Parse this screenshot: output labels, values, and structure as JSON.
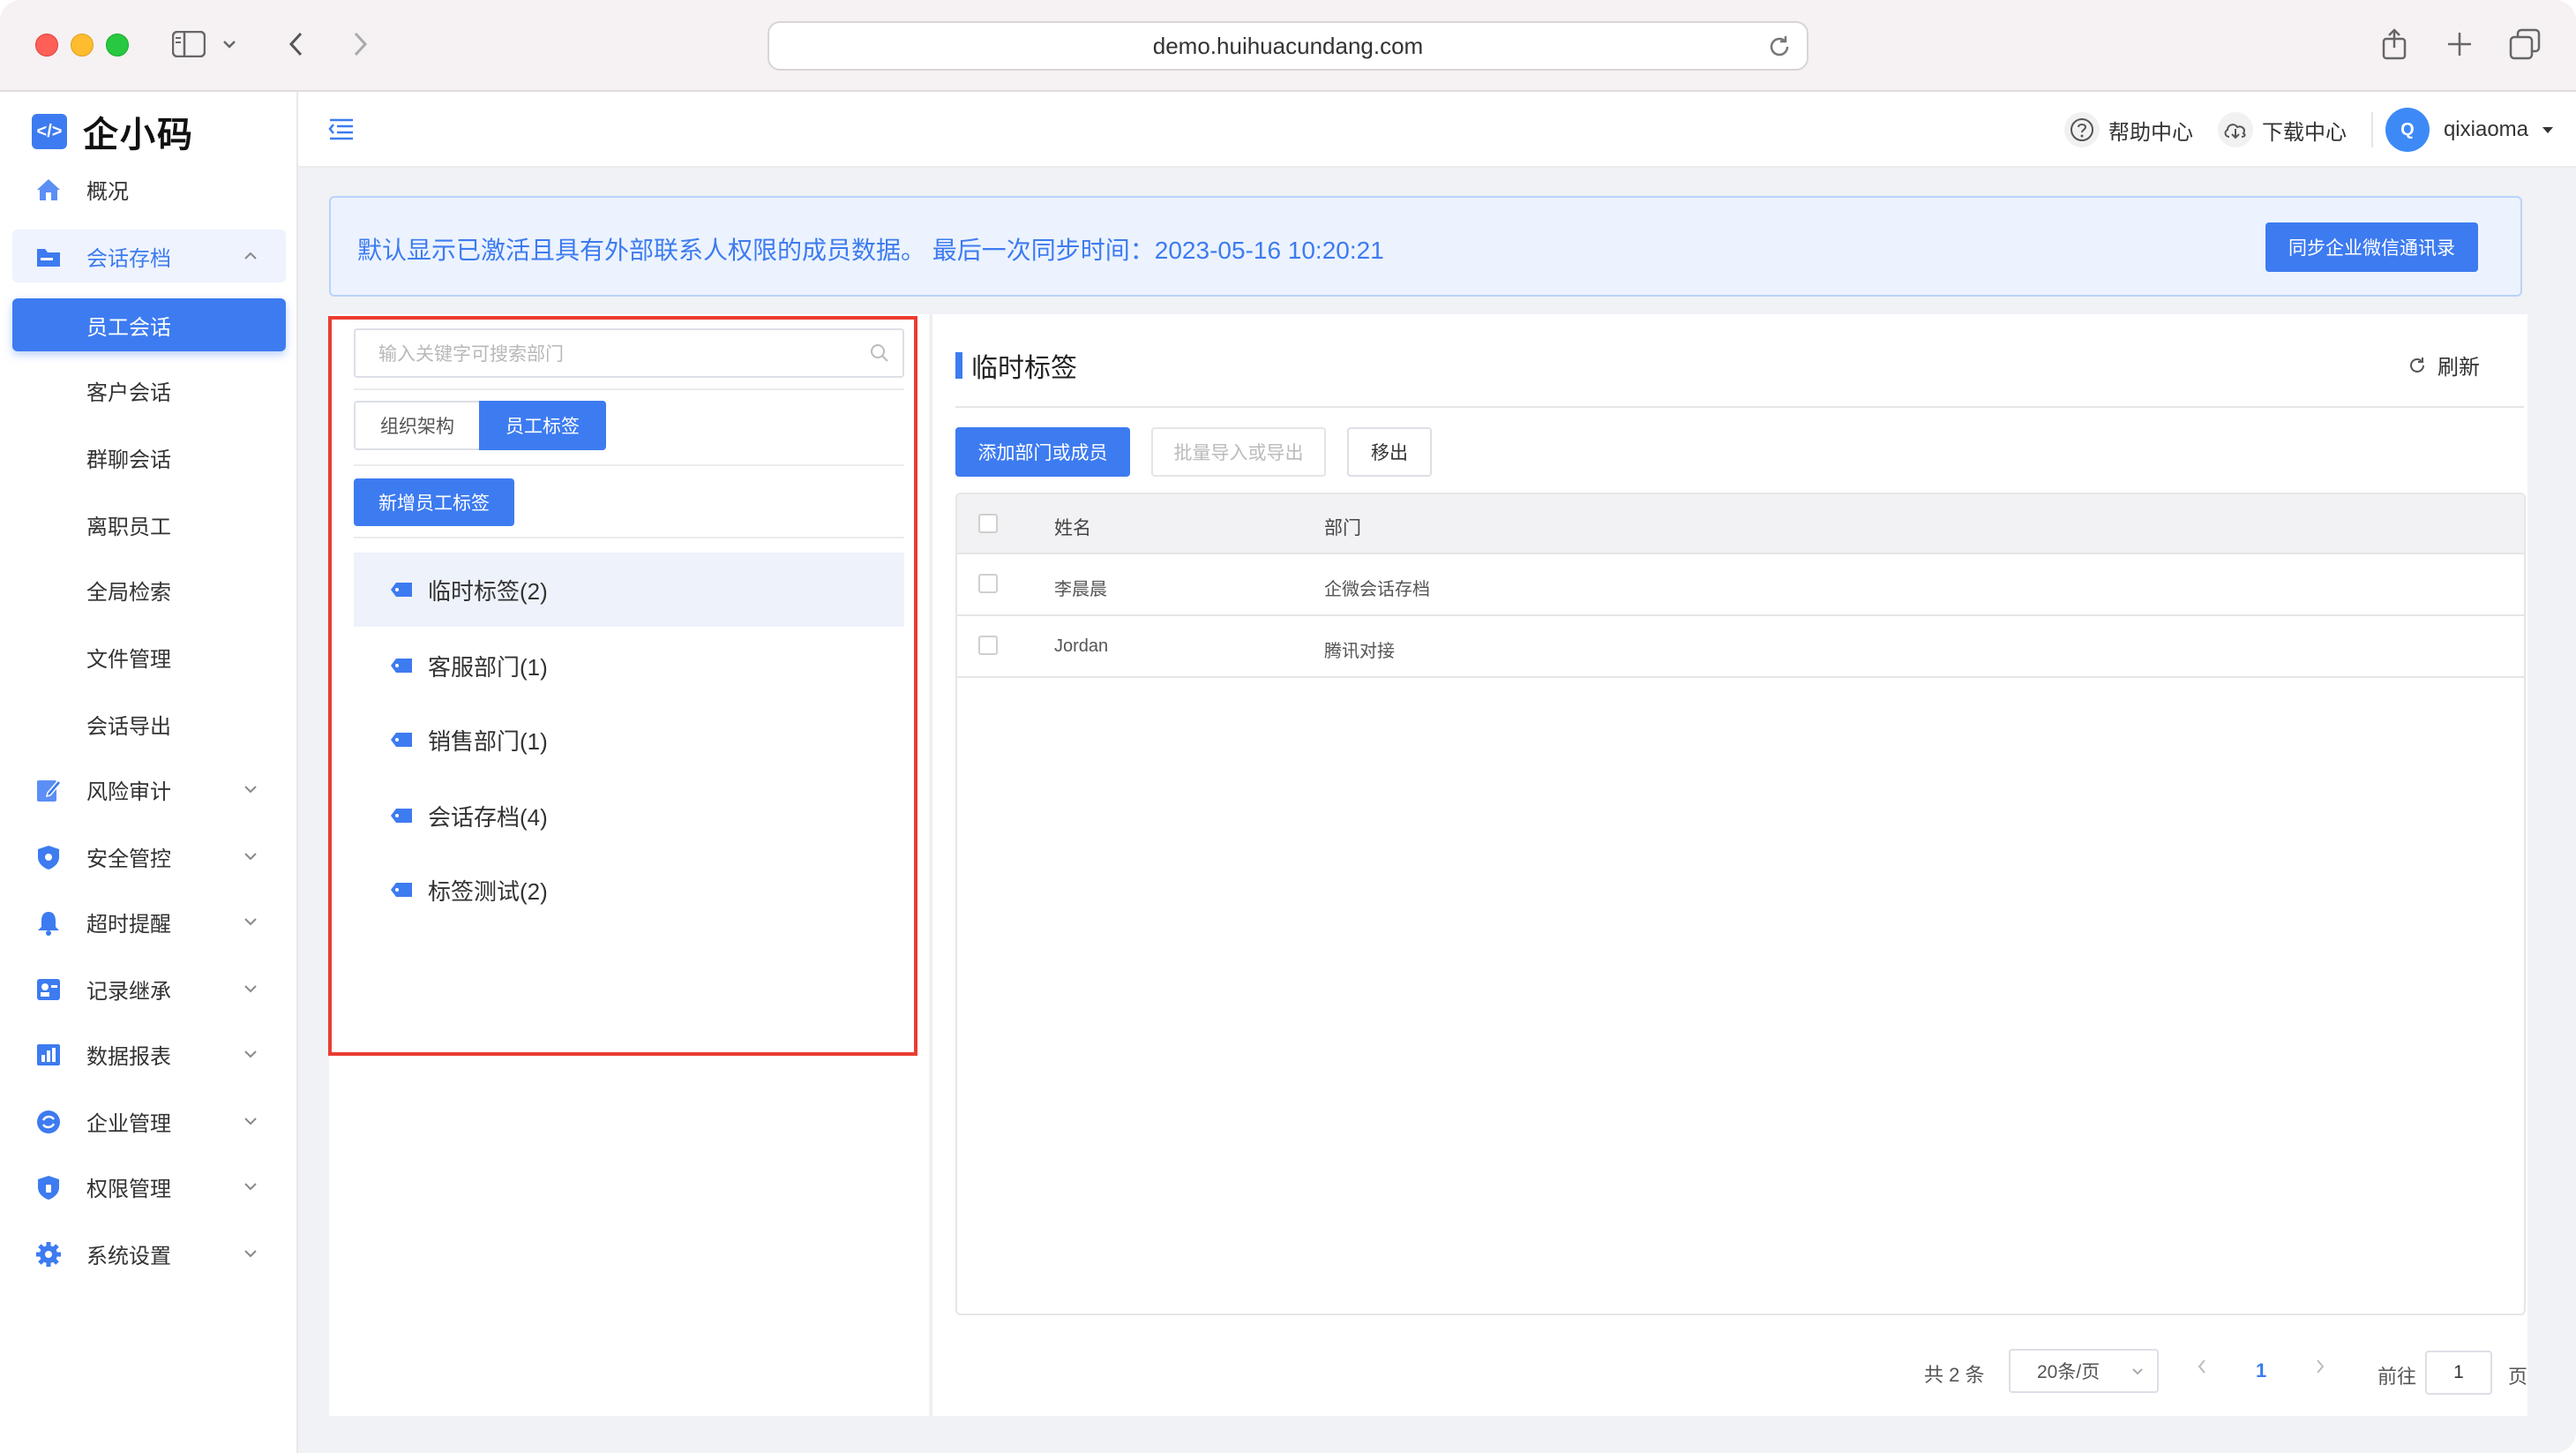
{
  "browser": {
    "url": "demo.huihuacundang.com"
  },
  "sidebar": {
    "logo_text": "企小码",
    "items": [
      {
        "label": "概况",
        "icon": "home-icon"
      },
      {
        "label": "会话存档",
        "icon": "folder-icon",
        "expanded": true
      },
      {
        "label": "员工会话",
        "active": true
      },
      {
        "label": "客户会话"
      },
      {
        "label": "群聊会话"
      },
      {
        "label": "离职员工"
      },
      {
        "label": "全局检索"
      },
      {
        "label": "文件管理"
      },
      {
        "label": "会话导出"
      },
      {
        "label": "风险审计",
        "icon": "edit-icon"
      },
      {
        "label": "安全管控",
        "icon": "shield-icon"
      },
      {
        "label": "超时提醒",
        "icon": "bell-icon"
      },
      {
        "label": "记录继承",
        "icon": "id-card-icon"
      },
      {
        "label": "数据报表",
        "icon": "bar-chart-icon"
      },
      {
        "label": "企业管理",
        "icon": "refresh-circle-icon"
      },
      {
        "label": "权限管理",
        "icon": "lock-shield-icon"
      },
      {
        "label": "系统设置",
        "icon": "gear-icon"
      }
    ]
  },
  "header": {
    "help_label": "帮助中心",
    "download_label": "下载中心",
    "avatar_letter": "Q",
    "username": "qixiaoma"
  },
  "notice": {
    "text": "默认显示已激活且具有外部联系人权限的成员数据。 最后一次同步时间：2023-05-16 10:20:21",
    "sync_button": "同步企业微信通讯录"
  },
  "left_panel": {
    "search_placeholder": "输入关键字可搜索部门",
    "tabs": [
      "组织架构",
      "员工标签"
    ],
    "active_tab": "员工标签",
    "add_tag_button": "新增员工标签",
    "tags": [
      {
        "label": "临时标签(2)",
        "selected": true
      },
      {
        "label": "客服部门(1)"
      },
      {
        "label": "销售部门(1)"
      },
      {
        "label": "会话存档(4)"
      },
      {
        "label": "标签测试(2)"
      }
    ]
  },
  "right_panel": {
    "title": "临时标签",
    "refresh_label": "刷新",
    "buttons": {
      "add": "添加部门或成员",
      "import_export": "批量导入或导出",
      "remove": "移出"
    },
    "table": {
      "columns": [
        "姓名",
        "部门"
      ],
      "rows": [
        {
          "name": "李晨晨",
          "dept": "企微会话存档"
        },
        {
          "name": "Jordan",
          "dept": "腾讯对接"
        }
      ]
    },
    "pagination": {
      "total": "共 2 条",
      "page_size": "20条/页",
      "current_page": "1",
      "goto_label": "前往",
      "goto_value": "1",
      "page_suffix": "页"
    }
  },
  "colors": {
    "accent": "#3d7bf0",
    "highlight_border": "#ea3c31"
  }
}
